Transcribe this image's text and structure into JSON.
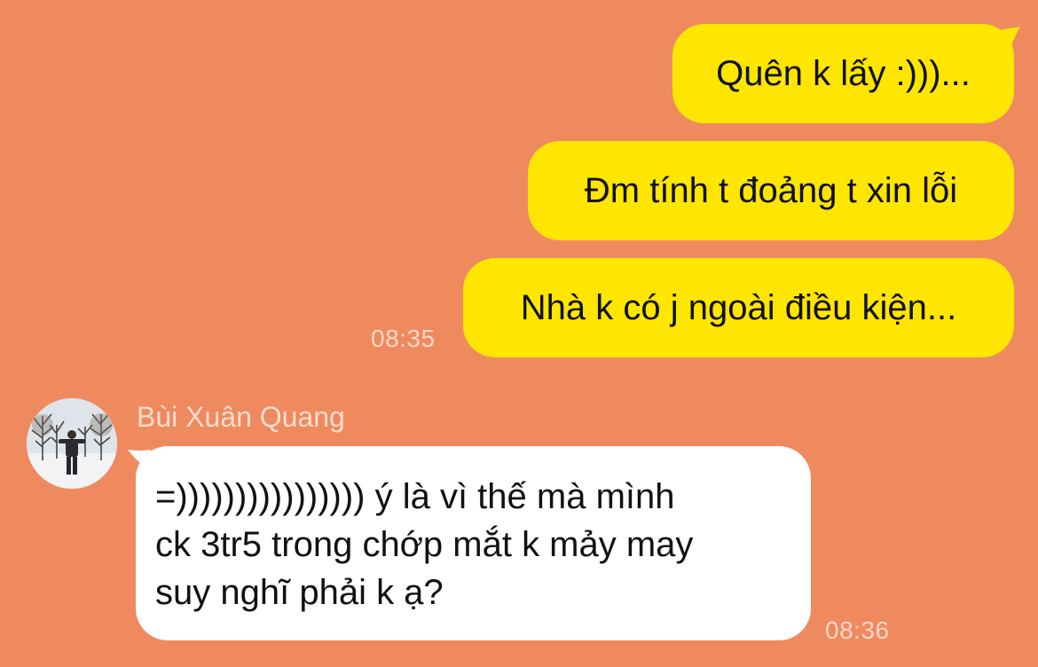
{
  "colors": {
    "background": "#ef8a5f",
    "outgoing_bubble": "#ffe600",
    "incoming_bubble": "#ffffff"
  },
  "messages_out": [
    {
      "text": "Quên k lấy :)))..."
    },
    {
      "text": "Đm tính t đoảng t xin lỗi"
    },
    {
      "text": "Nhà k có j ngoài điều kiện..."
    }
  ],
  "time_out": "08:35",
  "incoming": {
    "sender_name": "Bùi Xuân Quang",
    "avatar_icon": "user-avatar-photo",
    "lines": [
      "=)))))))))))))))) ý là vì thế mà mình",
      "ck 3tr5 trong chớp mắt k mảy may",
      "suy nghĩ phải k ạ?"
    ],
    "time": "08:36"
  }
}
